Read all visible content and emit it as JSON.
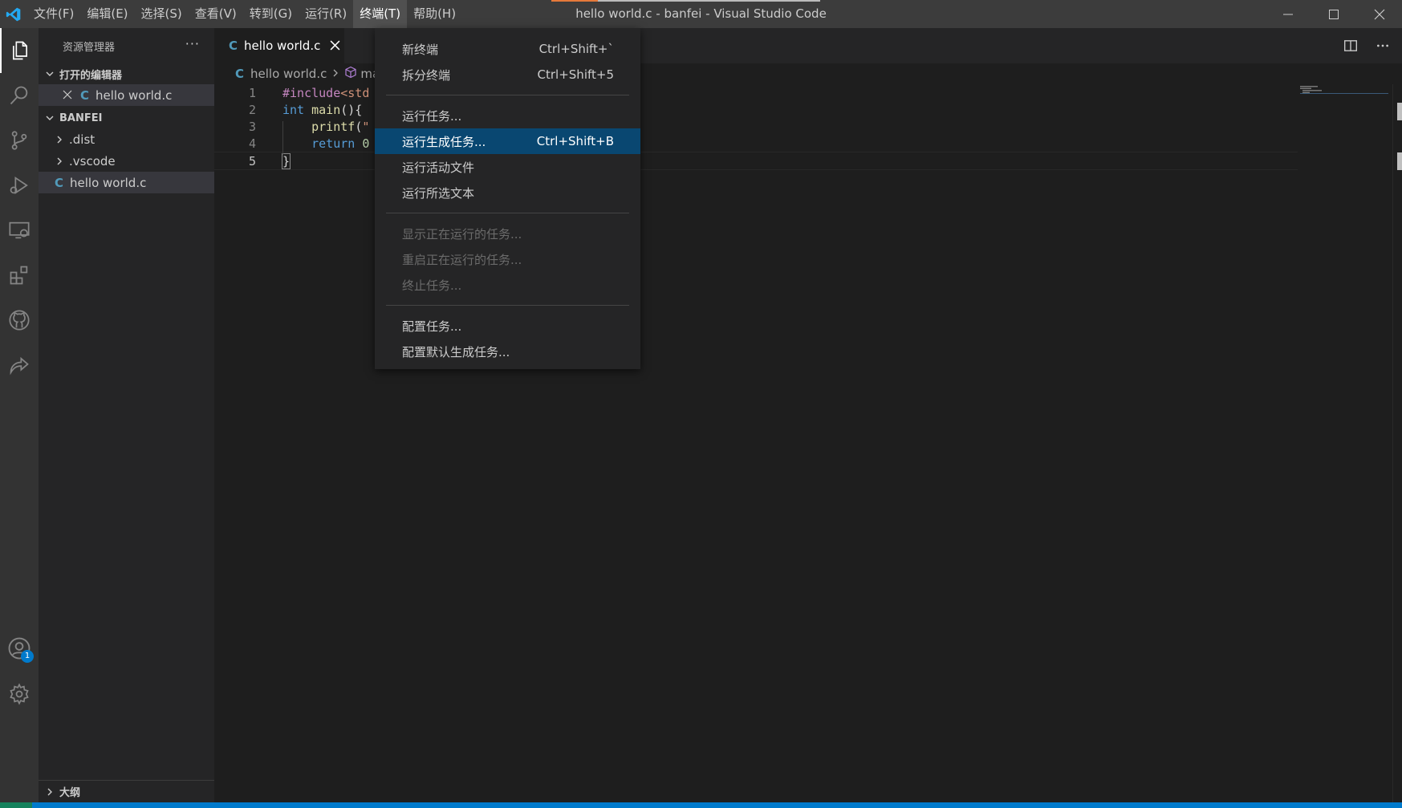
{
  "window": {
    "title": "hello world.c - banfei - Visual Studio Code"
  },
  "menubar": {
    "items": [
      {
        "label": "文件(F)"
      },
      {
        "label": "编辑(E)"
      },
      {
        "label": "选择(S)"
      },
      {
        "label": "查看(V)"
      },
      {
        "label": "转到(G)"
      },
      {
        "label": "运行(R)"
      },
      {
        "label": "终端(T)",
        "active": true
      },
      {
        "label": "帮助(H)"
      }
    ]
  },
  "activitybar": {
    "icons": [
      "explorer-icon",
      "search-icon",
      "source-control-icon",
      "run-debug-icon",
      "remote-explorer-icon",
      "extensions-icon",
      "github-icon",
      "live-share-icon",
      "account-icon",
      "settings-gear-icon"
    ],
    "account_badge": "1"
  },
  "sidebar": {
    "title": "资源管理器",
    "more": "···",
    "open_editors": {
      "label": "打开的编辑器",
      "files": [
        {
          "name": "hello world.c",
          "lang_glyph": "C"
        }
      ]
    },
    "workspace": {
      "label": "BANFEI",
      "items": [
        {
          "name": ".dist",
          "type": "folder"
        },
        {
          "name": ".vscode",
          "type": "folder"
        },
        {
          "name": "hello world.c",
          "type": "file",
          "lang_glyph": "C"
        }
      ]
    },
    "outline": {
      "label": "大纲"
    }
  },
  "tabs": [
    {
      "label": "hello world.c",
      "lang_glyph": "C",
      "active": true
    }
  ],
  "breadcrumb": {
    "file": "hello world.c",
    "lang_glyph": "C",
    "symbol": "ma"
  },
  "editor": {
    "lines": [
      {
        "num": "1",
        "parts": [
          {
            "t": "#include",
            "c": "inc"
          },
          {
            "t": "<std",
            "c": "str"
          }
        ]
      },
      {
        "num": "2",
        "parts": [
          {
            "t": "int",
            "c": "kw"
          },
          {
            "t": " ",
            "c": ""
          },
          {
            "t": "main",
            "c": "fn"
          },
          {
            "t": "(){",
            "c": ""
          }
        ]
      },
      {
        "num": "3",
        "parts": [
          {
            "t": "    ",
            "c": ""
          },
          {
            "t": "printf",
            "c": "fn"
          },
          {
            "t": "(",
            "c": ""
          },
          {
            "t": "\"",
            "c": "str"
          }
        ]
      },
      {
        "num": "4",
        "parts": [
          {
            "t": "    ",
            "c": ""
          },
          {
            "t": "return",
            "c": "kw"
          },
          {
            "t": " ",
            "c": ""
          },
          {
            "t": "0",
            "c": "num"
          }
        ]
      },
      {
        "num": "5",
        "parts": [
          {
            "t": "}",
            "c": ""
          }
        ]
      }
    ],
    "current_line": 5
  },
  "terminal_menu": {
    "groups": [
      [
        {
          "label": "新终端",
          "shortcut": "Ctrl+Shift+`"
        },
        {
          "label": "拆分终端",
          "shortcut": "Ctrl+Shift+5"
        }
      ],
      [
        {
          "label": "运行任务...",
          "shortcut": ""
        },
        {
          "label": "运行生成任务...",
          "shortcut": "Ctrl+Shift+B",
          "highlight": true
        },
        {
          "label": "运行活动文件",
          "shortcut": ""
        },
        {
          "label": "运行所选文本",
          "shortcut": ""
        }
      ],
      [
        {
          "label": "显示正在运行的任务...",
          "shortcut": "",
          "disabled": true
        },
        {
          "label": "重启正在运行的任务...",
          "shortcut": "",
          "disabled": true
        },
        {
          "label": "终止任务...",
          "shortcut": "",
          "disabled": true
        }
      ],
      [
        {
          "label": "配置任务...",
          "shortcut": ""
        },
        {
          "label": "配置默认生成任务...",
          "shortcut": ""
        }
      ]
    ]
  },
  "colors": {
    "accent": "#007acc",
    "menu_highlight": "#094771",
    "c_icon": "#519aba"
  }
}
